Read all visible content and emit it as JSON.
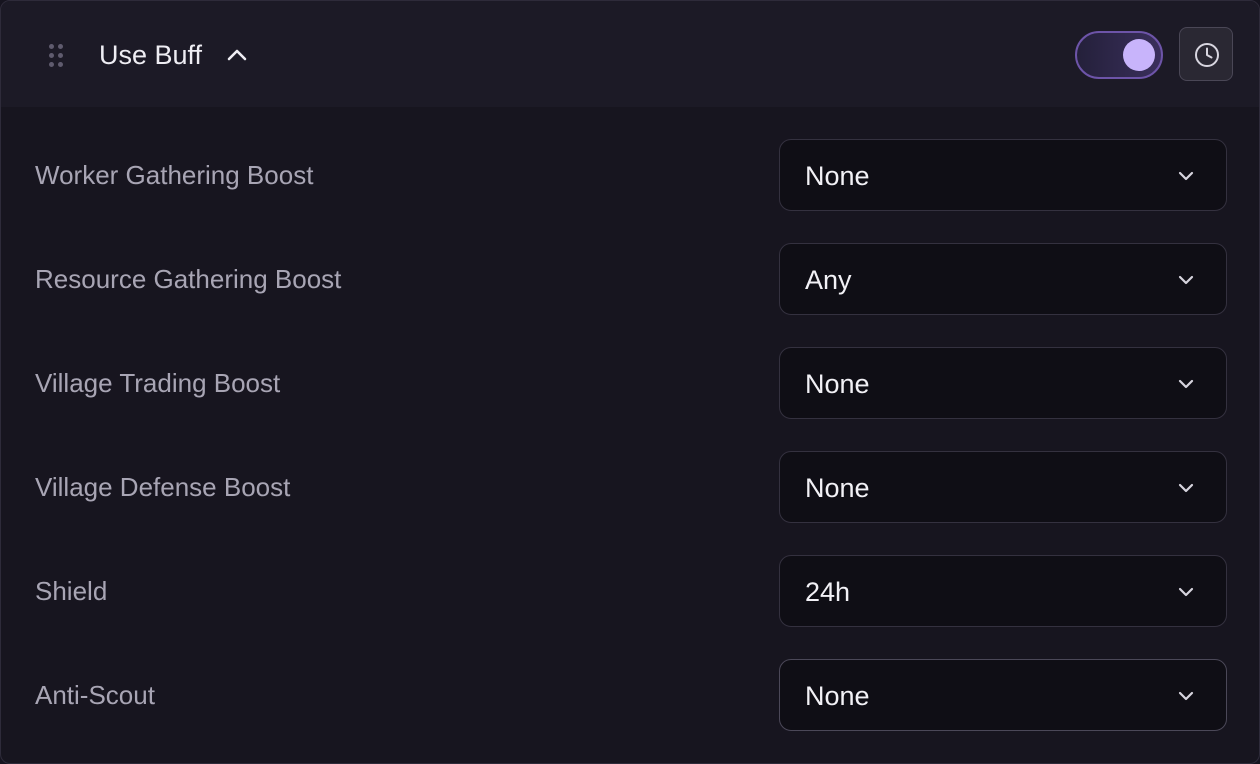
{
  "header": {
    "title": "Use Buff",
    "enabled": true,
    "icons": {
      "drag": "drag-handle-icon",
      "collapse": "chevron-up-icon",
      "history": "clock-icon"
    }
  },
  "settings": [
    {
      "label": "Worker Gathering Boost",
      "value": "None"
    },
    {
      "label": "Resource Gathering Boost",
      "value": "Any"
    },
    {
      "label": "Village Trading Boost",
      "value": "None"
    },
    {
      "label": "Village Defense Boost",
      "value": "None"
    },
    {
      "label": "Shield",
      "value": "24h"
    },
    {
      "label": "Anti-Scout",
      "value": "None"
    }
  ],
  "colors": {
    "accent": "#c8b4fb",
    "toggle_border": "#6d54a8",
    "background": "#17151f",
    "header_background": "#1c1a26",
    "select_background": "#0f0e15"
  }
}
